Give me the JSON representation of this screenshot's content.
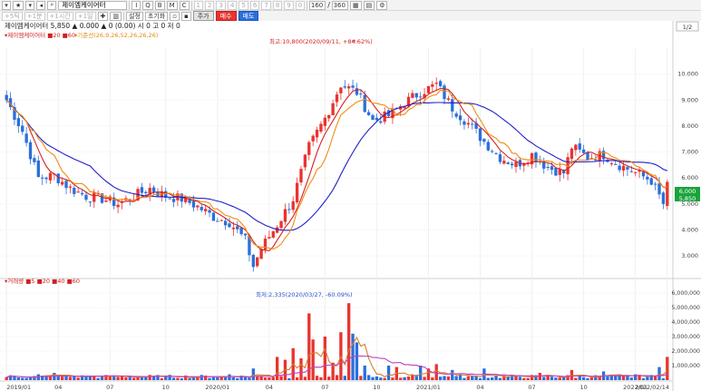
{
  "toolbar": {
    "stock_name": "제이엠케이어터",
    "buttons_row1": [
      "I",
      "Q",
      "B",
      "M",
      "C"
    ],
    "nums_row1": [
      "1",
      "2",
      "3",
      "4",
      "5",
      "6",
      "7",
      "8",
      "9",
      "0"
    ],
    "count_value": "160",
    "count_total": "360",
    "periods": [
      "+5틱",
      "+1분",
      "+1시간",
      "+1일"
    ],
    "setting_label": "설정",
    "init_label": "초기화",
    "tabs": [
      "주가",
      "매수",
      "매도"
    ],
    "colors": {
      "buy": "#e8342f",
      "sell": "#2a6fdc"
    }
  },
  "price_panel": {
    "info": "제이엠케이어터 5,850 ▲ 0.000 ▲ 0 (0.00) 시 0 고 0 저 0",
    "legend_ma": "▾제이엠케이어터 ■20 ■60",
    "legend_ichimoku": "▾기준선(26,9,26,52,26,26,26)",
    "high_annotation": "최고:10,800(2020/09/11, +84.62%)",
    "low_annotation": "최저:2,335(2020/03/27, -60.09%)",
    "y_ticks": [
      "10.000",
      "9.000",
      "8.000",
      "7.000",
      "6.000",
      "5.000",
      "4.000",
      "3.000"
    ],
    "price_label": "6,000",
    "price_label2": "5,850",
    "scale_btn": "1/2"
  },
  "volume_panel": {
    "legend": "▾거래량 ■5 ■20 ■40 ■60",
    "y_ticks": [
      "6,000,000",
      "5,000,000",
      "4,000,000",
      "3,000,000",
      "2,000,000",
      "1,000,000"
    ]
  },
  "x_axis": [
    "2019/01",
    "04",
    "07",
    "10",
    "2020/01",
    "04",
    "07",
    "10",
    "2021/01",
    "04",
    "07",
    "10",
    "2022/01",
    "2022/02/14"
  ],
  "chart_data": {
    "type": "candlestick",
    "price_range": [
      2200,
      11000
    ],
    "volume_range": [
      0,
      6500000
    ],
    "price_path": [
      [
        0,
        9000
      ],
      [
        4,
        7800
      ],
      [
        8,
        6000
      ],
      [
        12,
        6100
      ],
      [
        16,
        5600
      ],
      [
        20,
        5300
      ],
      [
        24,
        5200
      ],
      [
        28,
        5000
      ],
      [
        32,
        5300
      ],
      [
        36,
        5600
      ],
      [
        40,
        5300
      ],
      [
        44,
        5200
      ],
      [
        48,
        4900
      ],
      [
        52,
        4500
      ],
      [
        56,
        4300
      ],
      [
        60,
        3600
      ],
      [
        62,
        2600
      ],
      [
        64,
        3300
      ],
      [
        68,
        4200
      ],
      [
        72,
        5200
      ],
      [
        76,
        7200
      ],
      [
        80,
        8300
      ],
      [
        84,
        9600
      ],
      [
        88,
        9300
      ],
      [
        92,
        8200
      ],
      [
        96,
        8400
      ],
      [
        100,
        8900
      ],
      [
        104,
        9300
      ],
      [
        108,
        9600
      ],
      [
        112,
        8700
      ],
      [
        116,
        8100
      ],
      [
        120,
        7400
      ],
      [
        124,
        6800
      ],
      [
        128,
        6500
      ],
      [
        132,
        6900
      ],
      [
        136,
        6400
      ],
      [
        140,
        6200
      ],
      [
        142,
        7200
      ],
      [
        146,
        6800
      ],
      [
        150,
        6900
      ],
      [
        154,
        6500
      ],
      [
        158,
        6200
      ],
      [
        162,
        5900
      ],
      [
        165,
        5000
      ],
      [
        166,
        5850
      ]
    ],
    "volume_spikes": [
      [
        8,
        0.4
      ],
      [
        12,
        0.5
      ],
      [
        20,
        0.3
      ],
      [
        40,
        0.3
      ],
      [
        56,
        0.4
      ],
      [
        62,
        0.8
      ],
      [
        68,
        1.6
      ],
      [
        70,
        1.4
      ],
      [
        72,
        2.2
      ],
      [
        74,
        1.5
      ],
      [
        76,
        4.6
      ],
      [
        77,
        2.8
      ],
      [
        80,
        3.0
      ],
      [
        82,
        1.2
      ],
      [
        84,
        3.3
      ],
      [
        86,
        5.3
      ],
      [
        87,
        3.2
      ],
      [
        88,
        2.6
      ],
      [
        90,
        1.0
      ],
      [
        96,
        1.0
      ],
      [
        98,
        0.9
      ],
      [
        104,
        1.0
      ],
      [
        106,
        0.8
      ],
      [
        108,
        1.1
      ],
      [
        112,
        0.7
      ],
      [
        120,
        0.8
      ],
      [
        134,
        0.5
      ],
      [
        142,
        0.7
      ],
      [
        150,
        0.6
      ],
      [
        158,
        0.4
      ],
      [
        164,
        0.9
      ],
      [
        166,
        1.6
      ]
    ]
  }
}
